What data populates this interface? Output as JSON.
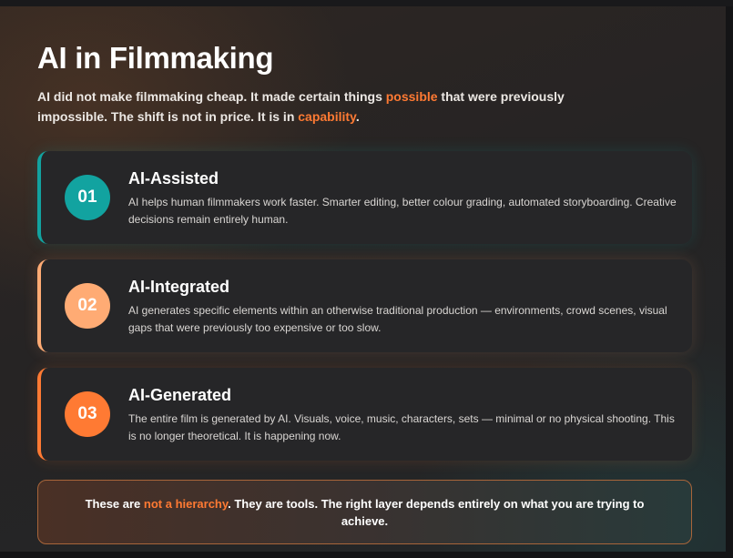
{
  "title": "AI in Filmmaking",
  "subtitle": {
    "part1": "AI did not make filmmaking cheap. It made certain things ",
    "highlight1": "possible",
    "part2": " that were previously impossible. The shift is not in price. It is in ",
    "highlight2": "capability",
    "part3": "."
  },
  "cards": [
    {
      "number": "01",
      "title": "AI-Assisted",
      "description": "AI helps human filmmakers work faster. Smarter editing, better colour grading, automated storyboarding. Creative decisions remain entirely human.",
      "accent": "#12a3a0"
    },
    {
      "number": "02",
      "title": "AI-Integrated",
      "description": "AI generates specific elements within an otherwise traditional production — environments, crowd scenes, visual gaps that were previously too expensive or too slow.",
      "accent": "#ffab74"
    },
    {
      "number": "03",
      "title": "AI-Generated",
      "description": "The entire film is generated by AI. Visuals, voice, music, characters, sets — minimal or no physical shooting. This is no longer theoretical. It is happening now.",
      "accent": "#ff7a33"
    }
  ],
  "callout": {
    "part1": "These are ",
    "highlight": "not a hierarchy",
    "part2": ". They are tools. The right layer depends entirely on what you are trying to achieve."
  },
  "colors": {
    "highlight": "#ff7a33",
    "teal": "#12a3a0",
    "peach": "#ffab74",
    "orange": "#ff7a33"
  }
}
